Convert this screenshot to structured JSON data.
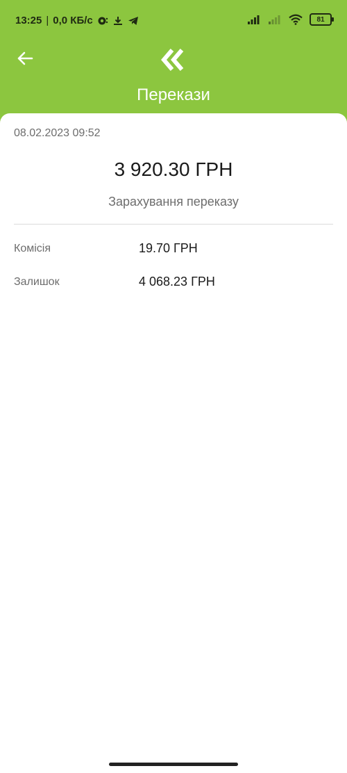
{
  "status_bar": {
    "time": "13:25",
    "separator": "|",
    "network_speed": "0,0 КБ/с",
    "battery": "81"
  },
  "header": {
    "title": "Перекази"
  },
  "transaction": {
    "datetime": "08.02.2023 09:52",
    "amount": "3 920.30 ГРН",
    "description": "Зарахування переказу",
    "details": [
      {
        "label": "Комісія",
        "value": "19.70 ГРН"
      },
      {
        "label": "Залишок",
        "value": "4 068.23 ГРН"
      }
    ]
  },
  "colors": {
    "brand_green": "#8cc63f",
    "card": "#ffffff"
  }
}
